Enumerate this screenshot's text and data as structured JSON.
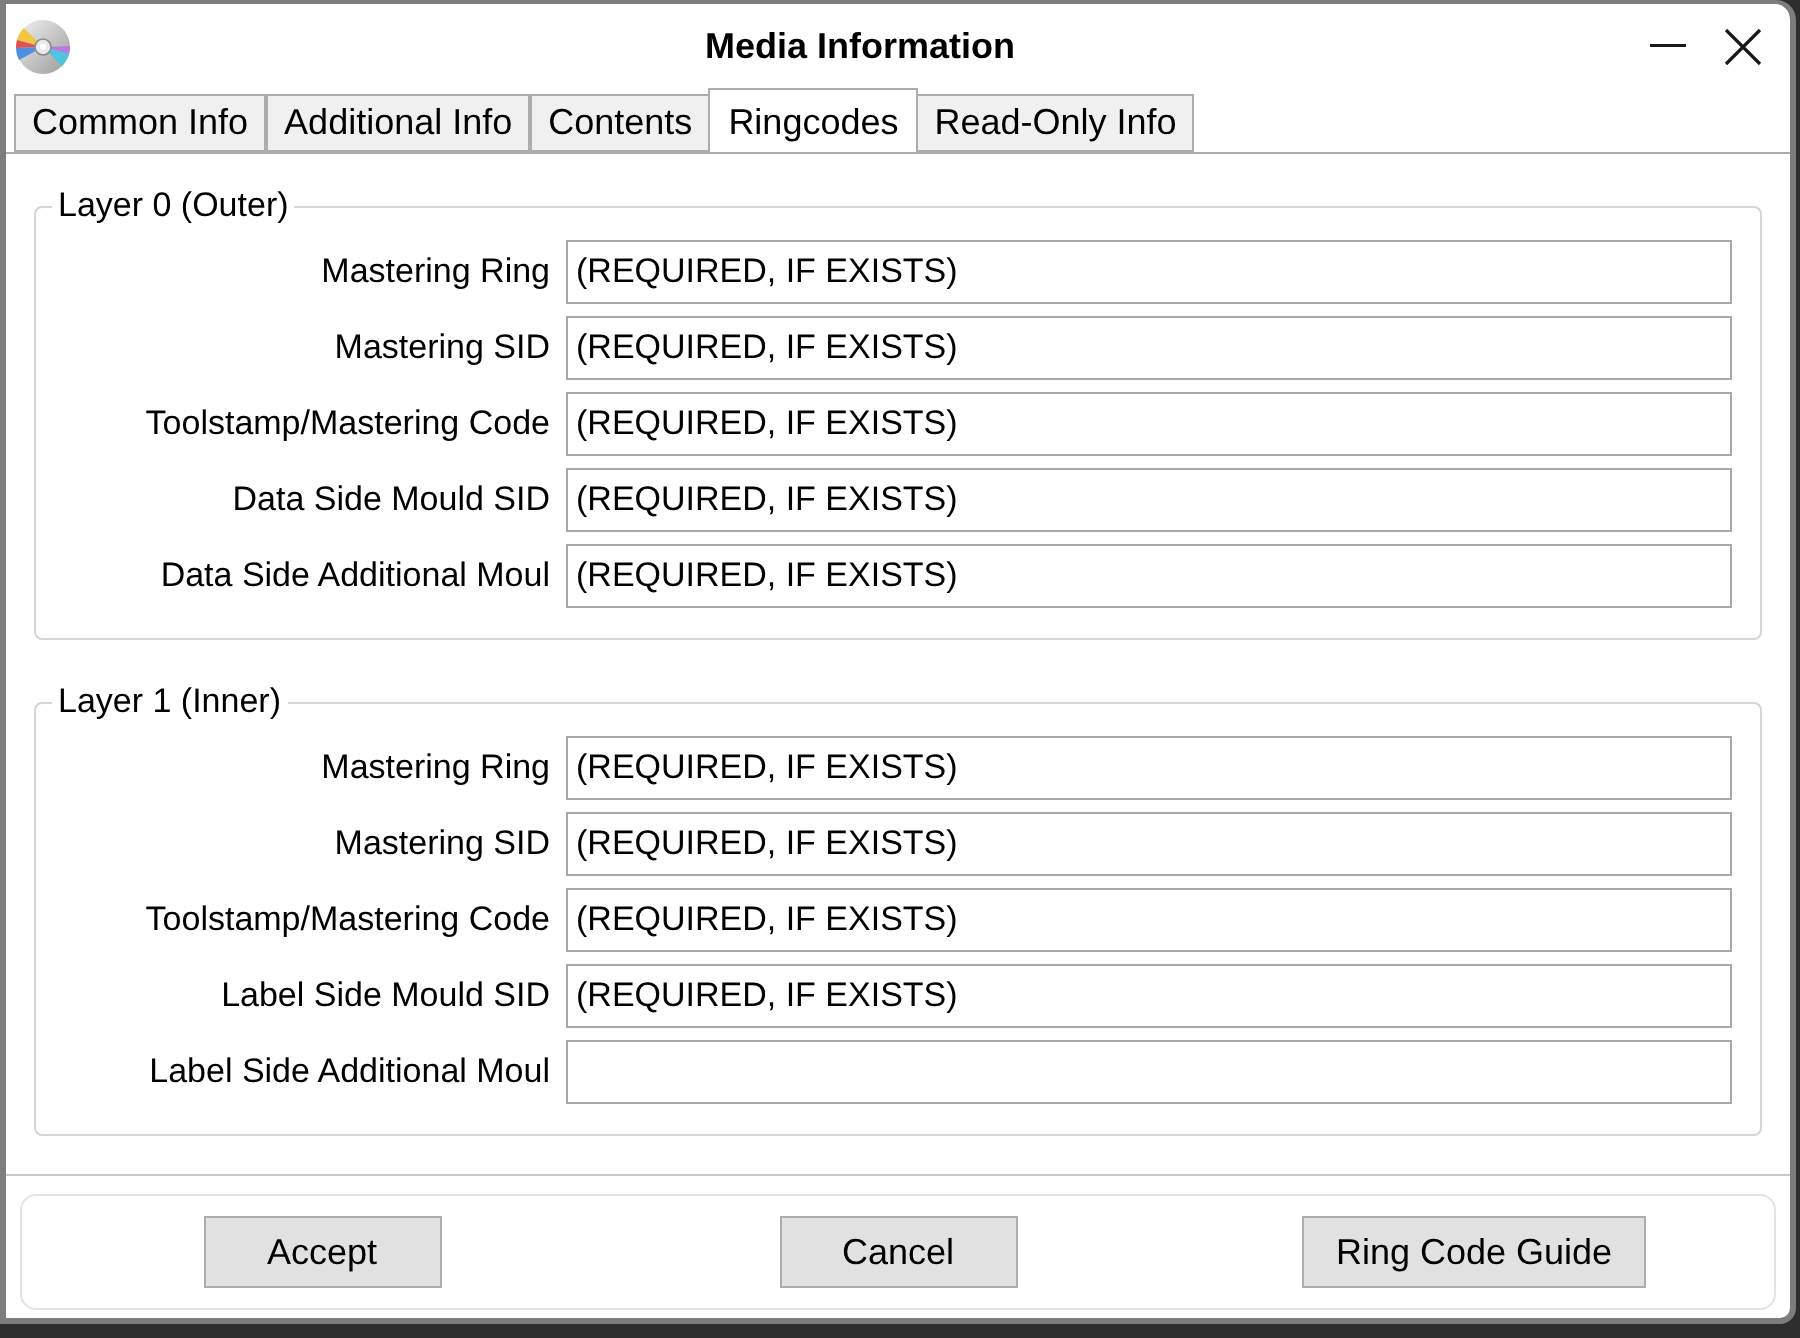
{
  "window": {
    "title": "Media Information"
  },
  "tabs": [
    {
      "label": "Common Info",
      "selected": false
    },
    {
      "label": "Additional Info",
      "selected": false
    },
    {
      "label": "Contents",
      "selected": false
    },
    {
      "label": "Ringcodes",
      "selected": true
    },
    {
      "label": "Read-Only Info",
      "selected": false
    }
  ],
  "groups": [
    {
      "legend": "Layer 0 (Outer)",
      "fields": [
        {
          "label": "Mastering Ring",
          "value": "(REQUIRED, IF EXISTS)"
        },
        {
          "label": "Mastering SID",
          "value": "(REQUIRED, IF EXISTS)"
        },
        {
          "label": "Toolstamp/Mastering Code",
          "value": "(REQUIRED, IF EXISTS)"
        },
        {
          "label": "Data Side Mould SID",
          "value": "(REQUIRED, IF EXISTS)"
        },
        {
          "label": "Data Side Additional Moul",
          "value": "(REQUIRED, IF EXISTS)"
        }
      ]
    },
    {
      "legend": "Layer 1 (Inner)",
      "fields": [
        {
          "label": "Mastering Ring",
          "value": "(REQUIRED, IF EXISTS)"
        },
        {
          "label": "Mastering SID",
          "value": "(REQUIRED, IF EXISTS)"
        },
        {
          "label": "Toolstamp/Mastering Code",
          "value": "(REQUIRED, IF EXISTS)"
        },
        {
          "label": "Label Side Mould SID",
          "value": "(REQUIRED, IF EXISTS)"
        },
        {
          "label": "Label Side Additional Moul"
        }
      ]
    }
  ],
  "buttons": [
    {
      "label": "Accept"
    },
    {
      "label": "Cancel"
    },
    {
      "label": "Ring Code Guide"
    }
  ]
}
